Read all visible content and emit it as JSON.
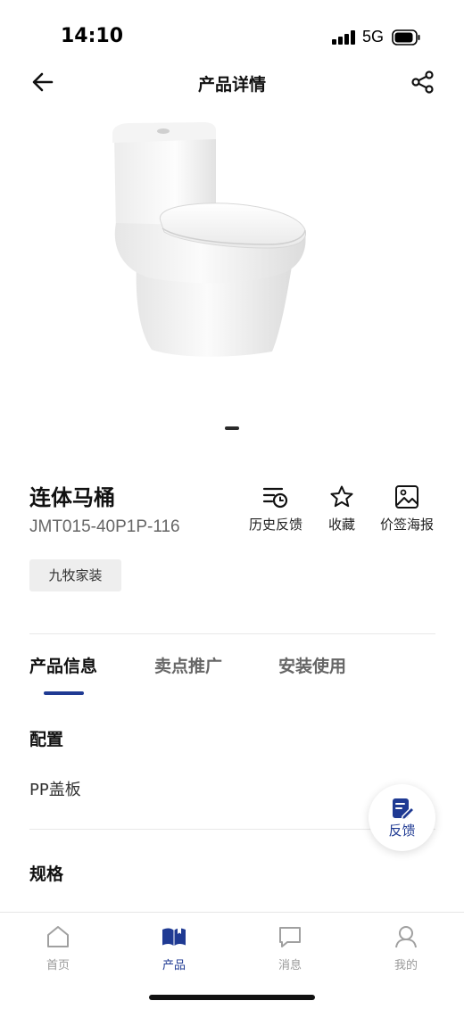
{
  "status_bar": {
    "time": "14:10",
    "network": "5G",
    "icons": [
      "signal-icon",
      "battery-icon"
    ]
  },
  "header": {
    "title": "产品详情",
    "back_icon": "arrow-left-icon",
    "share_icon": "share-icon"
  },
  "product": {
    "image": "toilet-product-photo",
    "carousel_page": 1,
    "name": "连体马桶",
    "model": "JMT015-40P1P-116",
    "brand_tag": "九牧家装"
  },
  "actions": [
    {
      "label": "历史反馈",
      "icon": "history-feedback-icon"
    },
    {
      "label": "收藏",
      "icon": "star-icon"
    },
    {
      "label": "价签海报",
      "icon": "image-icon"
    }
  ],
  "tabs": [
    {
      "label": "产品信息",
      "active": true
    },
    {
      "label": "卖点推广",
      "active": false
    },
    {
      "label": "安装使用",
      "active": false
    }
  ],
  "sections": [
    {
      "title": "配置",
      "value": "PP盖板"
    },
    {
      "title": "规格",
      "value": ""
    }
  ],
  "feedback_fab": {
    "label": "反馈",
    "icon": "edit-feedback-icon"
  },
  "bottom_nav": [
    {
      "label": "首页",
      "icon": "home-icon",
      "active": false
    },
    {
      "label": "产品",
      "icon": "book-icon",
      "active": true
    },
    {
      "label": "消息",
      "icon": "message-icon",
      "active": false
    },
    {
      "label": "我的",
      "icon": "user-icon",
      "active": false
    }
  ],
  "colors": {
    "accent": "#1f3a93",
    "text_primary": "#111111",
    "text_secondary": "#666666",
    "tag_bg": "#eeeeee",
    "nav_inactive": "#999999"
  }
}
